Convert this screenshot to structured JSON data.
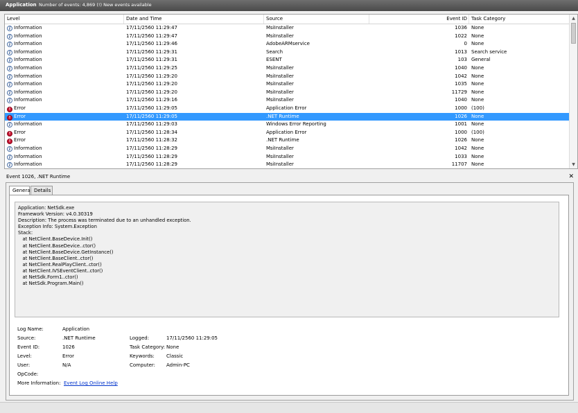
{
  "title_bar": {
    "app": "Application",
    "count_text": "Number of events: 4,869 (!) New events available"
  },
  "columns": [
    "Level",
    "Date and Time",
    "Source",
    "Event ID",
    "Task Category"
  ],
  "events": [
    {
      "level": "Information",
      "type": "info",
      "date": "17/11/2560 11:29:47",
      "source": "MsiInstaller",
      "id": "1036",
      "category": "None"
    },
    {
      "level": "Information",
      "type": "info",
      "date": "17/11/2560 11:29:47",
      "source": "MsiInstaller",
      "id": "1022",
      "category": "None"
    },
    {
      "level": "Information",
      "type": "info",
      "date": "17/11/2560 11:29:46",
      "source": "AdobeARMservice",
      "id": "0",
      "category": "None"
    },
    {
      "level": "Information",
      "type": "info",
      "date": "17/11/2560 11:29:31",
      "source": "Search",
      "id": "1013",
      "category": "Search service"
    },
    {
      "level": "Information",
      "type": "info",
      "date": "17/11/2560 11:29:31",
      "source": "ESENT",
      "id": "103",
      "category": "General"
    },
    {
      "level": "Information",
      "type": "info",
      "date": "17/11/2560 11:29:25",
      "source": "MsiInstaller",
      "id": "1040",
      "category": "None"
    },
    {
      "level": "Information",
      "type": "info",
      "date": "17/11/2560 11:29:20",
      "source": "MsiInstaller",
      "id": "1042",
      "category": "None"
    },
    {
      "level": "Information",
      "type": "info",
      "date": "17/11/2560 11:29:20",
      "source": "MsiInstaller",
      "id": "1035",
      "category": "None"
    },
    {
      "level": "Information",
      "type": "info",
      "date": "17/11/2560 11:29:20",
      "source": "MsiInstaller",
      "id": "11729",
      "category": "None"
    },
    {
      "level": "Information",
      "type": "info",
      "date": "17/11/2560 11:29:16",
      "source": "MsiInstaller",
      "id": "1040",
      "category": "None"
    },
    {
      "level": "Error",
      "type": "err",
      "date": "17/11/2560 11:29:05",
      "source": "Application Error",
      "id": "1000",
      "category": "(100)"
    },
    {
      "level": "Error",
      "type": "err",
      "date": "17/11/2560 11:29:05",
      "source": ".NET Runtime",
      "id": "1026",
      "category": "None",
      "selected": true
    },
    {
      "level": "Information",
      "type": "info",
      "date": "17/11/2560 11:29:03",
      "source": "Windows Error Reporting",
      "id": "1001",
      "category": "None"
    },
    {
      "level": "Error",
      "type": "err",
      "date": "17/11/2560 11:28:34",
      "source": "Application Error",
      "id": "1000",
      "category": "(100)"
    },
    {
      "level": "Error",
      "type": "err",
      "date": "17/11/2560 11:28:32",
      "source": ".NET Runtime",
      "id": "1026",
      "category": "None"
    },
    {
      "level": "Information",
      "type": "info",
      "date": "17/11/2560 11:28:29",
      "source": "MsiInstaller",
      "id": "1042",
      "category": "None"
    },
    {
      "level": "Information",
      "type": "info",
      "date": "17/11/2560 11:28:29",
      "source": "MsiInstaller",
      "id": "1033",
      "category": "None"
    },
    {
      "level": "Information",
      "type": "info",
      "date": "17/11/2560 11:28:29",
      "source": "MsiInstaller",
      "id": "11707",
      "category": "None"
    }
  ],
  "detail": {
    "title": "Event 1026, .NET Runtime",
    "close_glyph": "✕",
    "tabs": [
      "General",
      "Details"
    ],
    "description_lines": [
      "Application: NetSdk.exe",
      "Framework Version: v4.0.30319",
      "Description: The process was terminated due to an unhandled exception.",
      "Exception Info: System.Exception",
      "Stack:",
      "   at NetClient.BaseDevice.Init()",
      "   at NetClient.BaseDevice..ctor()",
      "   at NetClient.BaseDevice.GetInstance()",
      "   at NetClient.BaseClient..ctor()",
      "   at NetClient.RealPlayClient..ctor()",
      "   at NetClient.IVSEventClient..ctor()",
      "   at NetSdk.Form1..ctor()",
      "   at NetSdk.Program.Main()"
    ],
    "props": {
      "log_name_label": "Log Name:",
      "log_name": "Application",
      "source_label": "Source:",
      "source": ".NET Runtime",
      "logged_label": "Logged:",
      "logged": "17/11/2560 11:29:05",
      "event_id_label": "Event ID:",
      "event_id": "1026",
      "task_category_label": "Task Category:",
      "task_category": "None",
      "level_label": "Level:",
      "level": "Error",
      "keywords_label": "Keywords:",
      "keywords": "Classic",
      "user_label": "User:",
      "user": "N/A",
      "computer_label": "Computer:",
      "computer": "Admin-PC",
      "opcode_label": "OpCode:",
      "more_info_label": "More Information:",
      "more_info_link": "Event Log Online Help"
    }
  },
  "colors": {
    "selection": "#3399ff",
    "error_icon": "#c8102e",
    "link": "#0033cc"
  }
}
